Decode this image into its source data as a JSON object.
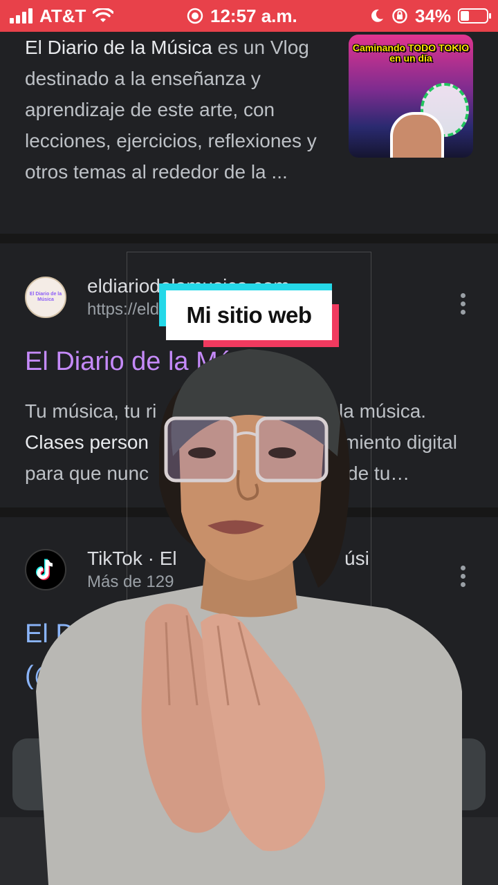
{
  "status": {
    "carrier": "AT&T",
    "time": "12:57 a.m.",
    "battery": "34%",
    "battery_level": 0.34
  },
  "result1": {
    "desc_bold": "El Diario de la Música",
    "desc_rest": " es un Vlog destinado a la enseñanza y aprendizaje de este arte, con lecciones, ejercicios, reflexiones y otros temas al rededor de la ...",
    "thumb_text": "Caminando TODO TOKIO en un día"
  },
  "result2": {
    "favicon_text": "El Diario de la Música",
    "site": "eldiariodelamusica.com",
    "url": "https://eldiariodelamusica.com",
    "title": "El Diario de la Música",
    "desc_1": "Tu música, tu ri",
    "desc_1b": "la música.",
    "desc_bold": "Clases person",
    "desc_2b": "miento digital",
    "desc_3": "para que nunc",
    "desc_3b": "de tu…"
  },
  "result3": {
    "site": "TikTok · El",
    "site_b": "úsi",
    "sub": "Más de 129",
    "title": "El D",
    "title_2": "(@"
  },
  "video": {
    "caption": "Mi sitio web"
  },
  "colors": {
    "status_bar": "#e8414a",
    "visited_link": "#c58af9",
    "link": "#8ab4f8",
    "caption_cyan": "#25d8e8",
    "caption_red": "#f03a5f"
  }
}
